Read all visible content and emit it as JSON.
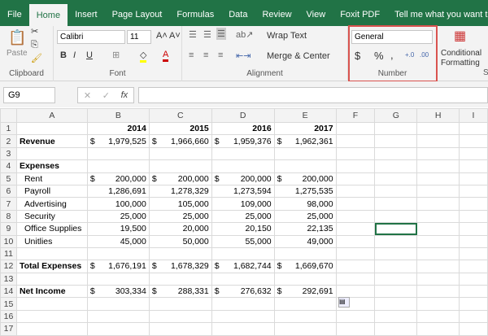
{
  "tabs": [
    "File",
    "Home",
    "Insert",
    "Page Layout",
    "Formulas",
    "Data",
    "Review",
    "View",
    "Foxit PDF"
  ],
  "tell_me": "Tell me what you want to do",
  "ribbon": {
    "clipboard": {
      "label": "Clipboard",
      "paste": "Paste"
    },
    "font": {
      "label": "Font",
      "name": "Calibri",
      "size": "11",
      "bold": "B",
      "italic": "I",
      "underline": "U"
    },
    "alignment": {
      "label": "Alignment",
      "wrap": "Wrap Text",
      "merge": "Merge & Center"
    },
    "number": {
      "label": "Number",
      "format": "General",
      "currency": "$",
      "percent": "%",
      "comma": ",",
      "inc": "+.0",
      "dec": ".00"
    },
    "styles": {
      "conditional": "Conditional",
      "formatting": "Formatting",
      "label": "St"
    }
  },
  "formula_bar": {
    "name_box": "G9",
    "value": ""
  },
  "columns": [
    "A",
    "B",
    "C",
    "D",
    "E",
    "F",
    "G",
    "H",
    "I"
  ],
  "rows": [
    {
      "n": "1",
      "label": "",
      "bold": true,
      "vals": [
        "2014",
        "2015",
        "2016",
        "2017"
      ],
      "dollar": false,
      "year": true
    },
    {
      "n": "2",
      "label": "Revenue",
      "bold": true,
      "vals": [
        "1,979,525",
        "1,966,660",
        "1,959,376",
        "1,962,361"
      ],
      "dollar": true
    },
    {
      "n": "3",
      "label": "",
      "vals": []
    },
    {
      "n": "4",
      "label": "Expenses",
      "bold": true,
      "vals": []
    },
    {
      "n": "5",
      "label": "Rent",
      "indent": true,
      "vals": [
        "200,000",
        "200,000",
        "200,000",
        "200,000"
      ],
      "dollar": true
    },
    {
      "n": "6",
      "label": "Payroll",
      "indent": true,
      "vals": [
        "1,286,691",
        "1,278,329",
        "1,273,594",
        "1,275,535"
      ]
    },
    {
      "n": "7",
      "label": "Advertising",
      "indent": true,
      "vals": [
        "100,000",
        "105,000",
        "109,000",
        "98,000"
      ]
    },
    {
      "n": "8",
      "label": "Security",
      "indent": true,
      "vals": [
        "25,000",
        "25,000",
        "25,000",
        "25,000"
      ]
    },
    {
      "n": "9",
      "label": "Office Supplies",
      "indent": true,
      "vals": [
        "19,500",
        "20,000",
        "20,150",
        "22,135"
      ]
    },
    {
      "n": "10",
      "label": "Unitlies",
      "indent": true,
      "vals": [
        "45,000",
        "50,000",
        "55,000",
        "49,000"
      ]
    },
    {
      "n": "11",
      "label": "",
      "vals": []
    },
    {
      "n": "12",
      "label": "Total Expenses",
      "bold": true,
      "vals": [
        "1,676,191",
        "1,678,329",
        "1,682,744",
        "1,669,670"
      ],
      "dollar": true
    },
    {
      "n": "13",
      "label": "",
      "vals": []
    },
    {
      "n": "14",
      "label": "Net Income",
      "bold": true,
      "vals": [
        "303,334",
        "288,331",
        "276,632",
        "292,691"
      ],
      "dollar": true
    },
    {
      "n": "15",
      "label": "",
      "vals": []
    },
    {
      "n": "16",
      "label": "",
      "vals": []
    },
    {
      "n": "17",
      "label": "",
      "vals": []
    }
  ],
  "currency_symbol": "$",
  "selected_cell": "G9"
}
